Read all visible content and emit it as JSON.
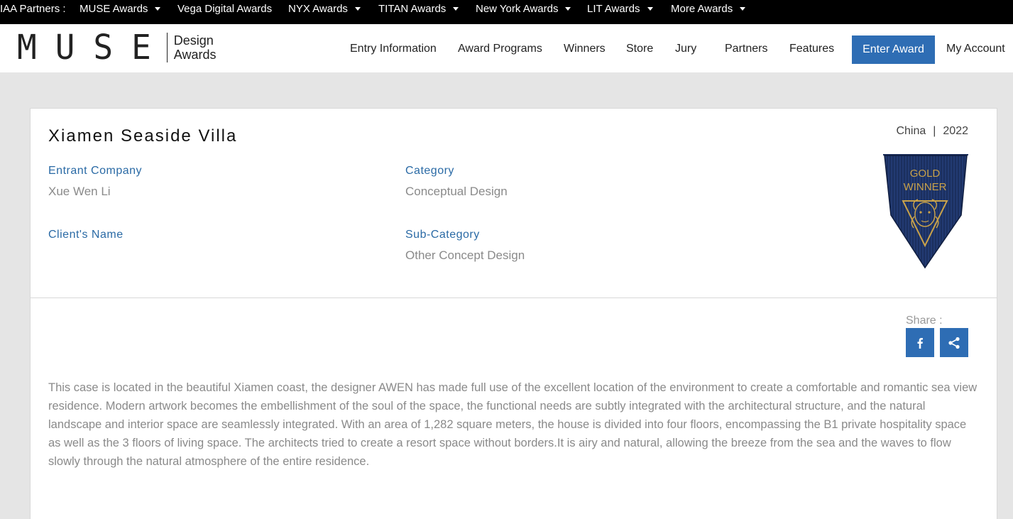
{
  "topbar": {
    "prefix": "IAA Partners :",
    "items": [
      {
        "label": "MUSE Awards",
        "dropdown": true
      },
      {
        "label": "Vega Digital Awards",
        "dropdown": false
      },
      {
        "label": "NYX Awards",
        "dropdown": true
      },
      {
        "label": "TITAN Awards",
        "dropdown": true
      },
      {
        "label": "New York Awards",
        "dropdown": true
      },
      {
        "label": "LIT Awards",
        "dropdown": true
      },
      {
        "label": "More Awards",
        "dropdown": true
      }
    ]
  },
  "header": {
    "logo": {
      "wordmark": "MUSE",
      "line1": "Design",
      "line2": "Awards"
    },
    "nav": [
      "Entry Information",
      "Award Programs",
      "Winners",
      "Store",
      "Jury",
      "Partners",
      "Features"
    ],
    "enter_label": "Enter Award",
    "account_label": "My Account"
  },
  "entry": {
    "title": "Xiamen Seaside Villa",
    "country": "China",
    "separator": "|",
    "year": "2022",
    "entrant_label": "Entrant Company",
    "entrant_value": "Xue Wen Li",
    "client_label": "Client's Name",
    "client_value": "",
    "category_label": "Category",
    "category_value": "Conceptual Design",
    "subcategory_label": "Sub-Category",
    "subcategory_value": "Other Concept Design",
    "badge": {
      "line1": "GOLD",
      "line2": "WINNER"
    },
    "share_label": "Share :",
    "description": "This case is located in the beautiful Xiamen coast, the designer AWEN has made full use of the excellent location of the environment to create a comfortable and romantic sea view residence. Modern artwork becomes the embellishment of the soul of the space, the functional needs are subtly integrated with the architectural structure, and the natural landscape and interior space are seamlessly integrated. With an area of 1,282 square meters, the house is divided into four floors, encompassing the B1 private hospitality space as well as the 3 floors of living space. The architects tried to create a resort space without borders.It is airy and natural, allowing the breeze from the sea and the waves to flow slowly through the natural atmosphere of the entire residence."
  },
  "colors": {
    "accent": "#2e6db4",
    "label": "#2a6aa5",
    "badge_navy": "#1a2d5c",
    "badge_gold": "#c9a24a"
  }
}
